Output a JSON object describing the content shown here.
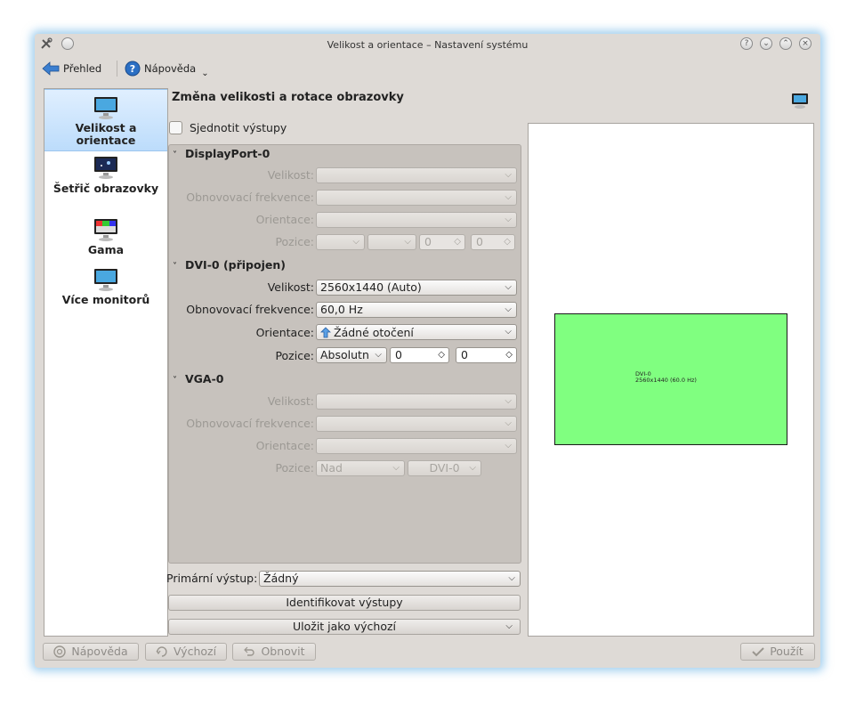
{
  "window": {
    "title": "Velikost a orientace – Nastavení systému"
  },
  "toolbar": {
    "overview_label": "Přehled",
    "help_label": "Nápověda"
  },
  "sidebar": {
    "items": [
      {
        "label": "Velikost a orientace",
        "selected": true
      },
      {
        "label": "Šetřič obrazovky",
        "selected": false
      },
      {
        "label": "Gama",
        "selected": false
      },
      {
        "label": "Více monitorů",
        "selected": false
      }
    ]
  },
  "main": {
    "heading": "Změna velikosti a rotace obrazovky",
    "unify_outputs_label": "Sjednotit výstupy",
    "outputs": [
      {
        "name": "DisplayPort-0",
        "enabled": false,
        "size_label": "Velikost:",
        "size_value": "",
        "refresh_label": "Obnovovací frekvence:",
        "refresh_value": "",
        "orientation_label": "Orientace:",
        "orientation_value": "",
        "position_label": "Pozice:",
        "position_mode": "",
        "position_ref": "",
        "x": "0",
        "y": "0"
      },
      {
        "name": "DVI-0 (připojen)",
        "enabled": true,
        "size_label": "Velikost:",
        "size_value": "2560x1440 (Auto)",
        "refresh_label": "Obnovovací frekvence:",
        "refresh_value": "60,0 Hz",
        "orientation_label": "Orientace:",
        "orientation_value": "Žádné otočení",
        "position_label": "Pozice:",
        "position_mode": "Absolutn",
        "x": "0",
        "y": "0"
      },
      {
        "name": "VGA-0",
        "enabled": false,
        "size_label": "Velikost:",
        "size_value": "",
        "refresh_label": "Obnovovací frekvence:",
        "refresh_value": "",
        "orientation_label": "Orientace:",
        "orientation_value": "",
        "position_label": "Pozice:",
        "position_mode": "Nad",
        "position_ref": "DVI-0"
      }
    ],
    "primary_output_label": "Primární výstup:",
    "primary_output_value": "Žádný",
    "identify_button": "Identifikovat výstupy",
    "save_default_button": "Uložit jako výchozí"
  },
  "preview": {
    "output_name": "DVI-0",
    "output_mode": "2560x1440 (60.0 Hz)",
    "color": "#80ff80"
  },
  "footer": {
    "help_button": "Nápověda",
    "defaults_button": "Výchozí",
    "reset_button": "Obnovit",
    "apply_button": "Použít"
  }
}
